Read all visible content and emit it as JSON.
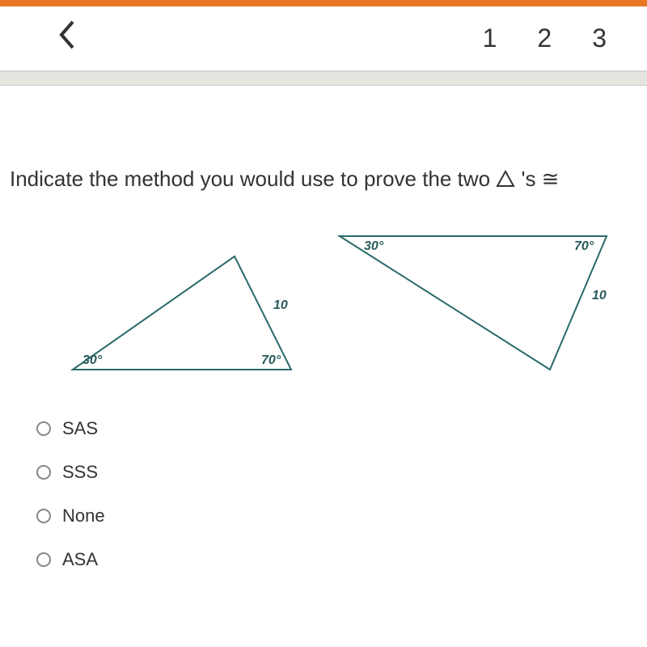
{
  "header": {
    "nav_numbers": [
      "1",
      "2",
      "3"
    ]
  },
  "question": {
    "text_before": "Indicate the method you would use to prove the two ",
    "text_after": " 's ≅"
  },
  "triangles": {
    "tri1": {
      "angle_left": "30°",
      "angle_right": "70°",
      "side": "10"
    },
    "tri2": {
      "angle_left": "30°",
      "angle_right": "70°",
      "side": "10"
    }
  },
  "options": [
    {
      "label": "SAS"
    },
    {
      "label": "SSS"
    },
    {
      "label": "None"
    },
    {
      "label": "ASA"
    }
  ]
}
